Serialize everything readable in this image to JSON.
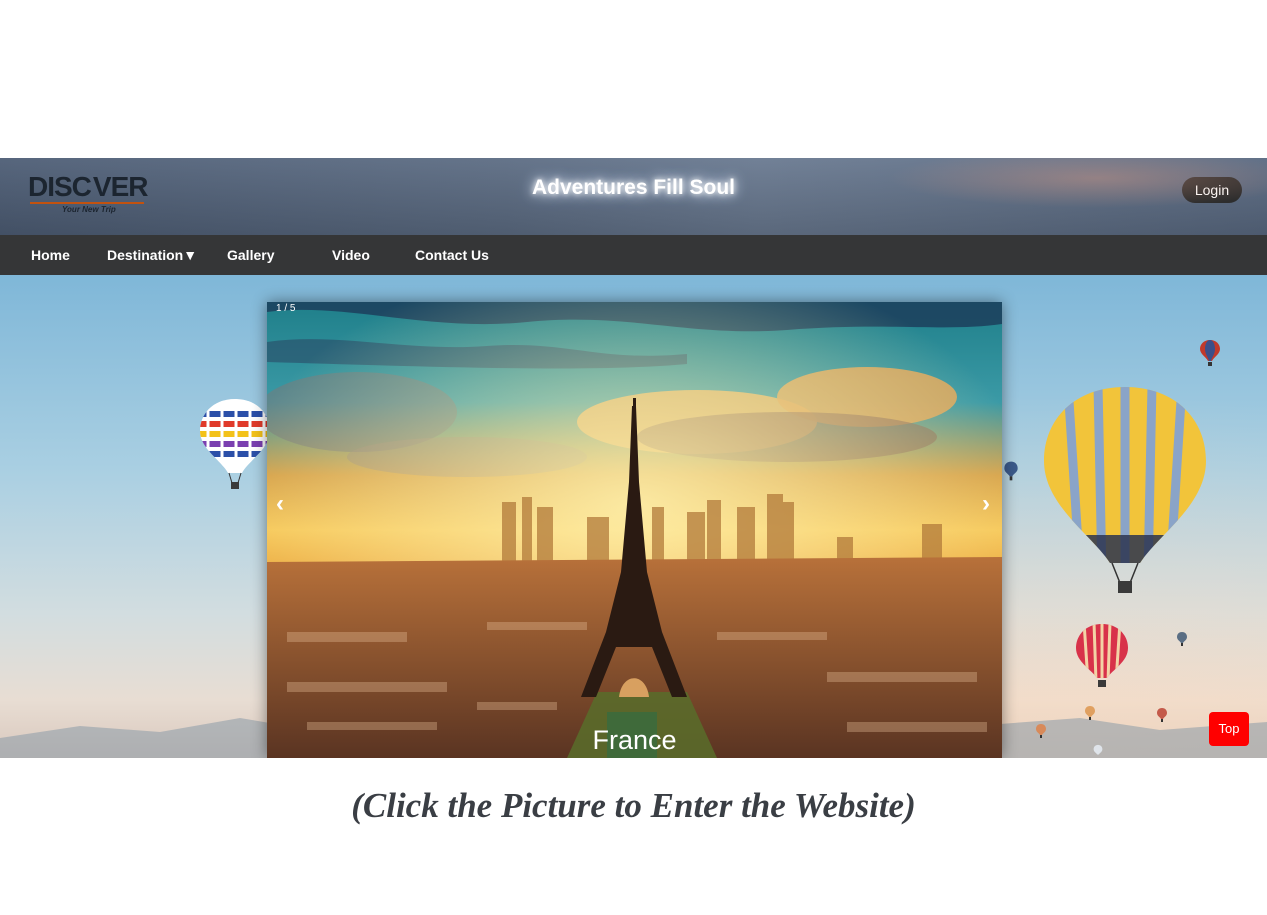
{
  "logo": {
    "brand_pre": "DISC",
    "brand_post": "VER",
    "tagline": "Your New Trip"
  },
  "header": {
    "title": "Adventures Fill Soul",
    "login_label": "Login"
  },
  "nav": {
    "items": [
      {
        "label": "Home"
      },
      {
        "label": "Destination▼"
      },
      {
        "label": "Gallery"
      },
      {
        "label": "Video"
      },
      {
        "label": "Contact Us"
      }
    ]
  },
  "slideshow": {
    "counter": "1 / 5",
    "prev_label": "‹",
    "next_label": "›",
    "caption": "France"
  },
  "top_button": {
    "label": "Top"
  },
  "instruction": "(Click the Picture to Enter the Website)",
  "colors": {
    "nav_bg": "#353637",
    "top_button": "#ff0000",
    "login_bg": "#2d2d2d"
  }
}
